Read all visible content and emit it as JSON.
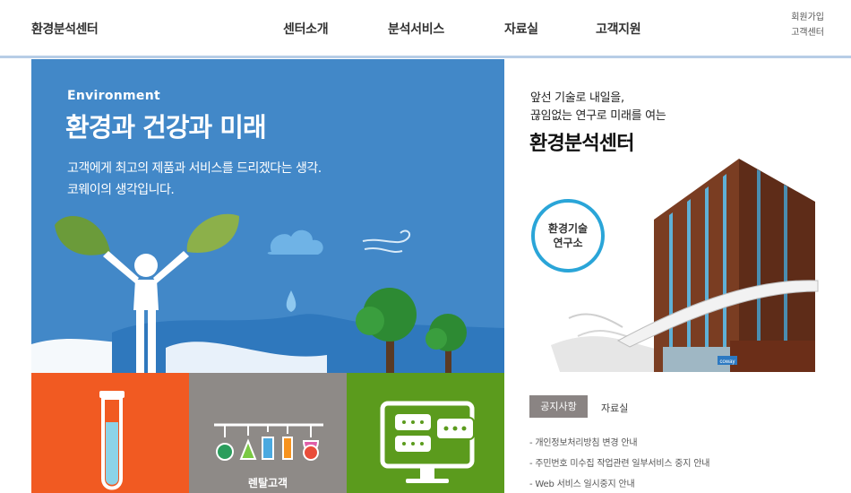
{
  "header": {
    "logo": "환경분석센터",
    "nav": [
      "센터소개",
      "분석서비스",
      "자료실",
      "고객지원"
    ],
    "util": [
      "회원가입",
      "고객센터"
    ]
  },
  "hero": {
    "eyebrow": "Environment",
    "title": "환경과 건강과 미래",
    "desc_line1": "고객에게 최고의 제품과 서비스를 드리겠다는 생각.",
    "desc_line2": "코웨이의 생각입니다."
  },
  "promo": {
    "sub_line1": "앞선 기술로 내일을,",
    "sub_line2": "끊임없는 연구로 미래를 여는",
    "title": "환경분석센터",
    "badge_line1": "환경기술",
    "badge_line2": "연구소",
    "sign": "coway"
  },
  "tiles": [
    {
      "label": "",
      "icon": "test-tube-icon",
      "color": "#f15a22"
    },
    {
      "label": "렌탈고객",
      "icon": "lab-flasks-icon",
      "color": "#8e8a87"
    },
    {
      "label": "",
      "icon": "chat-monitor-icon",
      "color": "#5b9b1d"
    }
  ],
  "notice": {
    "tabs": [
      "공지사항",
      "자료실"
    ],
    "items": [
      "- 개인정보처리방침 변경 안내",
      "- 주민번호 미수집 작업관련 일부서비스 중지 안내",
      "- Web 서비스 일시중지 안내"
    ]
  },
  "colors": {
    "hero_bg": "#4288c8",
    "accent_ring": "#2aa5d8",
    "tile_orange": "#f15a22",
    "tile_gray": "#8e8a87",
    "tile_green": "#5b9b1d"
  }
}
